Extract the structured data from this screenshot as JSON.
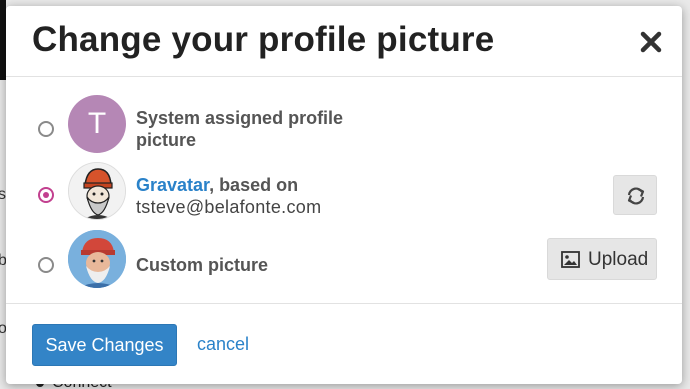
{
  "background": {
    "text_s": "s",
    "text_b": "b",
    "text_ok": "ok",
    "connect": "Connect"
  },
  "modal": {
    "title": "Change your profile picture",
    "close_icon": "close-icon"
  },
  "options": [
    {
      "id": "system",
      "selected": false,
      "avatar_letter": "T",
      "avatar_color": "#b587b5",
      "label": "System assigned profile picture"
    },
    {
      "id": "gravatar",
      "selected": true,
      "link_text": "Gravatar",
      "label_suffix": ", based on",
      "email": "tsteve@belafonte.com",
      "action_icon": "refresh-icon"
    },
    {
      "id": "custom",
      "selected": false,
      "label": "Custom picture",
      "upload_label": "Upload",
      "upload_icon": "image-icon"
    }
  ],
  "footer": {
    "save_label": "Save Changes",
    "cancel_label": "cancel"
  },
  "colors": {
    "primary": "#3384c7",
    "link": "#2a82c9",
    "radio_selected": "#c2408f"
  }
}
